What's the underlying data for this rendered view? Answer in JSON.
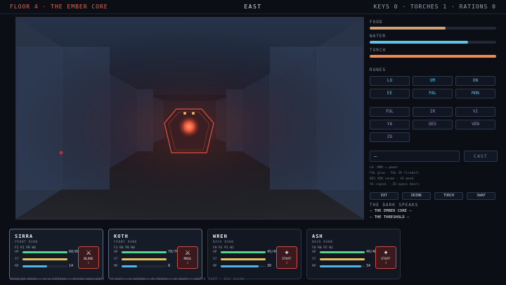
{
  "topbar": {
    "floor_title": "FLOOR 4 · THE EMBER CORE",
    "facing": "EAST",
    "inventory": "KEYS 0 · TORCHES 1 · RATIONS 0"
  },
  "resources": [
    {
      "label": "FOOD",
      "level": 0.6,
      "color": "#cfa27a"
    },
    {
      "label": "WATER",
      "level": 0.78,
      "color": "#5fc3e6"
    },
    {
      "label": "TORCH",
      "level": 1.0,
      "color": "#ee8a4e"
    }
  ],
  "runes": {
    "label": "RUNES",
    "items": [
      {
        "text": "LO",
        "color": "#4fc9e0"
      },
      {
        "text": "UM",
        "color": "#4fc9e0"
      },
      {
        "text": "ON",
        "color": "#4fc9e0"
      },
      {
        "text": "EE",
        "color": "#4fc9e0"
      },
      {
        "text": "PAL",
        "color": "#4fc9e0"
      },
      {
        "text": "MON",
        "color": "#4fc9e0"
      },
      {
        "text": "FUL",
        "color": "#a58ad9"
      },
      {
        "text": "IR",
        "color": "#a58ad9"
      },
      {
        "text": "VI",
        "color": "#a58ad9"
      },
      {
        "text": "YA",
        "color": "#a58ad9"
      },
      {
        "text": "DES",
        "color": "#a58ad9"
      },
      {
        "text": "VEN",
        "color": "#a58ad9"
      },
      {
        "text": "ZO",
        "color": "#a58ad9"
      }
    ]
  },
  "spell": {
    "input_value": "—",
    "cast_label": "CAST",
    "hints": [
      "LO..MON = power",
      "FUL glow · FUL IR fireball",
      "DES VEN venom · VI mend",
      "YA signal · ZO opens doors"
    ]
  },
  "actions": [
    "EAT",
    "DRINK",
    "TORCH",
    "SWAP"
  ],
  "log": {
    "heading": "THE DARK SPEAKS",
    "messages": [
      "— THE EMBER CORE —",
      "— THE THRESHOLD —"
    ]
  },
  "party": [
    {
      "name": "SIRRA",
      "rank": "FRONT RANK",
      "stats": "F2 R1 P0 W0",
      "hp_text": "60/60",
      "hp": 1.0,
      "st": 1.0,
      "mp_text": "14",
      "mp": 0.55,
      "weapon": {
        "glyph": "⚔",
        "name": "BLADE",
        "hotkey": "1"
      },
      "active": true
    },
    {
      "name": "KOTH",
      "rank": "FRONT RANK",
      "stats": "F3 R0 P0 W0",
      "hp_text": "70/70",
      "hp": 1.0,
      "st": 1.0,
      "mp_text": "8",
      "mp": 0.35,
      "weapon": {
        "glyph": "⚔",
        "name": "MAUL",
        "hotkey": "2"
      },
      "active": true
    },
    {
      "name": "WREN",
      "rank": "BACK RANK",
      "stats": "F0 R1 P1 W2",
      "hp_text": "45/45",
      "hp": 1.0,
      "st": 1.0,
      "mp_text": "30",
      "mp": 0.85,
      "weapon": {
        "glyph": "✦",
        "name": "STAFF",
        "hotkey": "3"
      },
      "active": false
    },
    {
      "name": "ASH",
      "rank": "BACK RANK",
      "stats": "F0 R0 P2 W1",
      "hp_text": "40/40",
      "hp": 1.0,
      "st": 1.0,
      "mp_text": "34",
      "mp": 0.92,
      "weapon": {
        "glyph": "✦",
        "name": "STAFF",
        "hotkey": "4"
      },
      "active": false
    }
  ],
  "keyhelp": "WASD/QE MOVE · 1-4 STRIKE · SPACE USE/GRAB · F EAT · G DRINK · R TORCH · Z SWAP · ENTER CAST · ESC CLEAR",
  "colors": {
    "accent": "#e8664f",
    "hp": "#59d38a",
    "st": "#e6c35a",
    "mp": "#4fb6e6",
    "enemy_outline": "#e0503e"
  }
}
